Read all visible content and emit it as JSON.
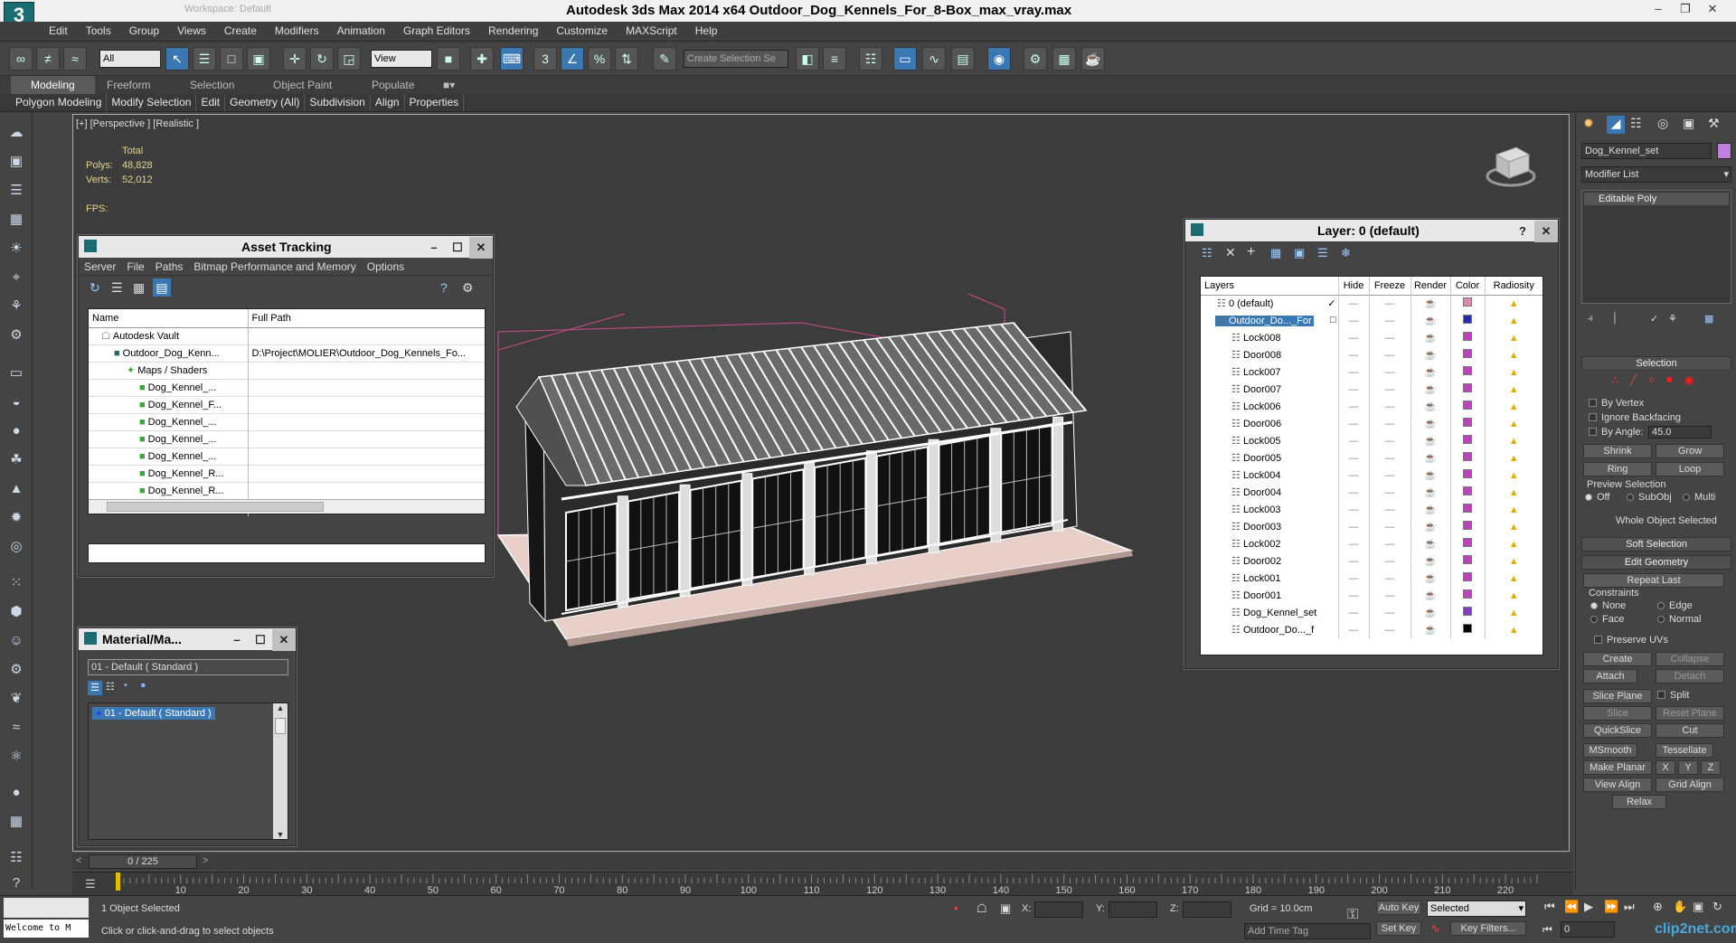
{
  "title": "Autodesk 3ds Max  2014 x64     Outdoor_Dog_Kennels_For_8-Box_max_vray.max",
  "workspace": "Workspace: Default",
  "menu": [
    "Edit",
    "Tools",
    "Group",
    "Views",
    "Create",
    "Modifiers",
    "Animation",
    "Graph Editors",
    "Rendering",
    "Customize",
    "MAXScript",
    "Help"
  ],
  "toolbar": {
    "filter": "All",
    "ref_coord": "View",
    "selection_set_placeholder": "Create Selection Se"
  },
  "ribbon": {
    "tabs": [
      "Modeling",
      "Freeform",
      "Selection",
      "Object Paint",
      "Populate"
    ],
    "groups": [
      "Polygon Modeling",
      "Modify Selection",
      "Edit",
      "Geometry (All)",
      "Subdivision",
      "Align",
      "Properties"
    ]
  },
  "viewport": {
    "label": "[+] [Perspective ] [Realistic ]",
    "total": "Total",
    "polys_label": "Polys:",
    "polys": "48,828",
    "verts_label": "Verts:",
    "verts": "52,012",
    "fps_label": "FPS:"
  },
  "asset_tracking": {
    "title": "Asset Tracking",
    "menu": [
      "Server",
      "File",
      "Paths",
      "Bitmap Performance and Memory",
      "Options"
    ],
    "col_name": "Name",
    "col_path": "Full Path",
    "rows": [
      {
        "name": "Autodesk Vault",
        "path": "",
        "indent": 1
      },
      {
        "name": "Outdoor_Dog_Kenn...",
        "path": "D:\\Project\\MOLIER\\Outdoor_Dog_Kennels_Fo...",
        "indent": 2
      },
      {
        "name": "Maps / Shaders",
        "path": "",
        "indent": 3
      },
      {
        "name": "Dog_Kennel_...",
        "path": "",
        "indent": 4
      },
      {
        "name": "Dog_Kennel_F...",
        "path": "",
        "indent": 4
      },
      {
        "name": "Dog_Kennel_...",
        "path": "",
        "indent": 4
      },
      {
        "name": "Dog_Kennel_...",
        "path": "",
        "indent": 4
      },
      {
        "name": "Dog_Kennel_...",
        "path": "",
        "indent": 4
      },
      {
        "name": "Dog_Kennel_R...",
        "path": "",
        "indent": 4
      },
      {
        "name": "Dog_Kennel_R...",
        "path": "",
        "indent": 4
      }
    ]
  },
  "material": {
    "title": "Material/Ma...",
    "current": "01 - Default  ( Standard )",
    "item": "01 - Default  ( Standard )"
  },
  "layer": {
    "title": "Layer: 0 (default)",
    "help": "?",
    "cols": [
      "Layers",
      "Hide",
      "Freeze",
      "Render",
      "Color",
      "Radiosity"
    ],
    "rows": [
      {
        "name": "0 (default)",
        "color": "#e08ab0",
        "level": 0
      },
      {
        "name": "Outdoor_Do..._For",
        "color": "#2a2ab0",
        "level": 0,
        "selected": true
      },
      {
        "name": "Lock008",
        "color": "#c040c0",
        "level": 1
      },
      {
        "name": "Door008",
        "color": "#c040c0",
        "level": 1
      },
      {
        "name": "Lock007",
        "color": "#c040c0",
        "level": 1
      },
      {
        "name": "Door007",
        "color": "#c040c0",
        "level": 1
      },
      {
        "name": "Lock006",
        "color": "#c040c0",
        "level": 1
      },
      {
        "name": "Door006",
        "color": "#c040c0",
        "level": 1
      },
      {
        "name": "Lock005",
        "color": "#c040c0",
        "level": 1
      },
      {
        "name": "Door005",
        "color": "#c040c0",
        "level": 1
      },
      {
        "name": "Lock004",
        "color": "#c040c0",
        "level": 1
      },
      {
        "name": "Door004",
        "color": "#c040c0",
        "level": 1
      },
      {
        "name": "Lock003",
        "color": "#c040c0",
        "level": 1
      },
      {
        "name": "Door003",
        "color": "#c040c0",
        "level": 1
      },
      {
        "name": "Lock002",
        "color": "#c040c0",
        "level": 1
      },
      {
        "name": "Door002",
        "color": "#c040c0",
        "level": 1
      },
      {
        "name": "Lock001",
        "color": "#c040c0",
        "level": 1
      },
      {
        "name": "Door001",
        "color": "#c040c0",
        "level": 1
      },
      {
        "name": "Dog_Kennel_set",
        "color": "#8040c0",
        "level": 1
      },
      {
        "name": "Outdoor_Do..._f",
        "color": "#000000",
        "level": 1
      }
    ]
  },
  "command_panel": {
    "object_name": "Dog_Kennel_set",
    "object_color": "#c080e0",
    "modifier_list": "Modifier List",
    "stack_item": "Editable Poly",
    "selection": "Selection",
    "by_vertex": "By Vertex",
    "ignore_backfacing": "Ignore Backfacing",
    "by_angle": "By Angle:",
    "angle_value": "45.0",
    "shrink": "Shrink",
    "grow": "Grow",
    "ring": "Ring",
    "loop": "Loop",
    "preview_selection": "Preview Selection",
    "off": "Off",
    "subobj": "SubObj",
    "multi": "Multi",
    "whole_object": "Whole Object Selected",
    "soft_selection": "Soft Selection",
    "edit_geometry": "Edit Geometry",
    "repeat_last": "Repeat Last",
    "constraints": "Constraints",
    "none": "None",
    "edge": "Edge",
    "face": "Face",
    "normal": "Normal",
    "preserve_uvs": "Preserve UVs",
    "create": "Create",
    "collapse": "Collapse",
    "attach": "Attach",
    "detach": "Detach",
    "slice_plane": "Slice Plane",
    "split": "Split",
    "slice": "Slice",
    "reset_plane": "Reset Plane",
    "quickslice": "QuickSlice",
    "cut": "Cut",
    "msmooth": "MSmooth",
    "tessellate": "Tessellate",
    "make_planar": "Make Planar",
    "x": "X",
    "y": "Y",
    "z": "Z",
    "view_align": "View Align",
    "grid_align": "Grid Align",
    "relax": "Relax"
  },
  "timeline": {
    "frame": "0 / 225",
    "ticks": [
      "10",
      "20",
      "30",
      "40",
      "50",
      "60",
      "70",
      "80",
      "90",
      "100",
      "110",
      "120",
      "130",
      "140",
      "150",
      "160",
      "170",
      "180",
      "190",
      "200",
      "210",
      "220"
    ]
  },
  "status": {
    "welcome": "Welcome to M",
    "selected": "1 Object Selected",
    "prompt": "Click or click-and-drag to select objects",
    "x": "X:",
    "y": "Y:",
    "z": "Z:",
    "grid": "Grid = 10.0cm",
    "add_time_tag": "Add Time Tag",
    "auto_key": "Auto Key",
    "set_key": "Set Key",
    "key_mode": "Selected",
    "key_filters": "Key Filters...",
    "frame_value": "0",
    "watermark": "clip2net.com"
  }
}
